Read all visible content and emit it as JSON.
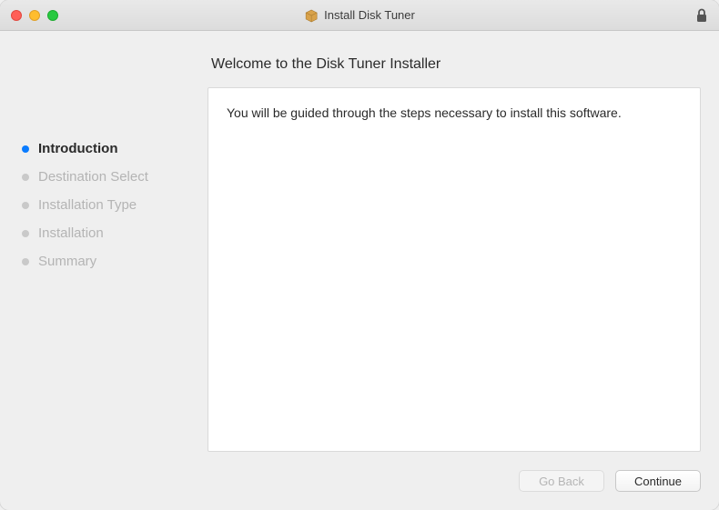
{
  "window": {
    "title": "Install Disk Tuner"
  },
  "heading": "Welcome to the Disk Tuner Installer",
  "body_text": "You will be guided through the steps necessary to install this software.",
  "sidebar": {
    "steps": [
      {
        "label": "Introduction",
        "active": true
      },
      {
        "label": "Destination Select",
        "active": false
      },
      {
        "label": "Installation Type",
        "active": false
      },
      {
        "label": "Installation",
        "active": false
      },
      {
        "label": "Summary",
        "active": false
      }
    ]
  },
  "buttons": {
    "back": "Go Back",
    "continue": "Continue"
  }
}
